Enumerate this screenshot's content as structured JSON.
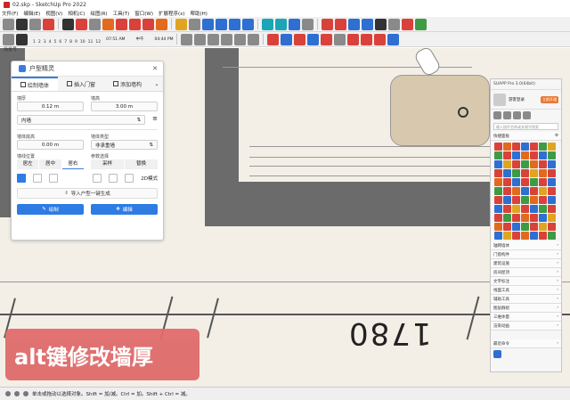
{
  "window": {
    "title": "02.skp - SketchUp Pro 2022"
  },
  "menu": [
    "文件(F)",
    "编辑(E)",
    "视图(V)",
    "相机(C)",
    "绘图(R)",
    "工具(T)",
    "窗口(W)",
    "扩展程序(x)",
    "帮助(H)"
  ],
  "toolbar": {
    "ruler_ticks": [
      "1",
      "2",
      "3",
      "4",
      "5",
      "6",
      "7",
      "8",
      "9",
      "10",
      "11",
      "12"
    ],
    "time_start": "07:51 AM",
    "time_mid": "中午",
    "time_end": "04:44 PM"
  },
  "scene": {
    "label": "场景号"
  },
  "drawing": {
    "dimension": "1780"
  },
  "plugin": {
    "title": "户型精灵",
    "tabs": [
      "绘制墙体",
      "插入门窗",
      "添加墙构"
    ],
    "wall_height_label": "墙厚",
    "wall_height_value": "0.12 m",
    "wall_top_label": "墙高",
    "wall_top_value": "3.00 m",
    "wall_type_value": "内墙",
    "ceiling_label": "墙体底高",
    "ceiling_value": "0.00 m",
    "wall_kind_label": "墙体类型",
    "wall_kind_value": "非承重墙",
    "pos_label": "墙线位置",
    "pos_options": [
      "居左",
      "居中",
      "居右"
    ],
    "ref_label": "参数选择",
    "ref_options": [
      "采样",
      "替换"
    ],
    "mode_2d": "2D模式",
    "import_label": "导入户型一键生成",
    "draw_button": "绘制",
    "edit_button": "编辑"
  },
  "suapp": {
    "title": "SUAPP Pro 3.0(64bit)",
    "user_label": "游客登录",
    "vip_label": "立即开通",
    "search_placeholder": "输入插件名称或关键字搜索",
    "panel_label": "快捷面板",
    "categories": [
      "轴网墙体",
      "门窗构件",
      "建筑设施",
      "房间屋顶",
      "文字标注",
      "线面工具",
      "辅助工具",
      "图层群组",
      "三维体量",
      "渲染动画"
    ],
    "footer": "最近命令"
  },
  "caption": "alt键修改墙厚",
  "status": {
    "text": "单击或拖动以选择对象。Shift = 加/减。Ctrl = 加。Shift + Ctrl = 减。"
  }
}
